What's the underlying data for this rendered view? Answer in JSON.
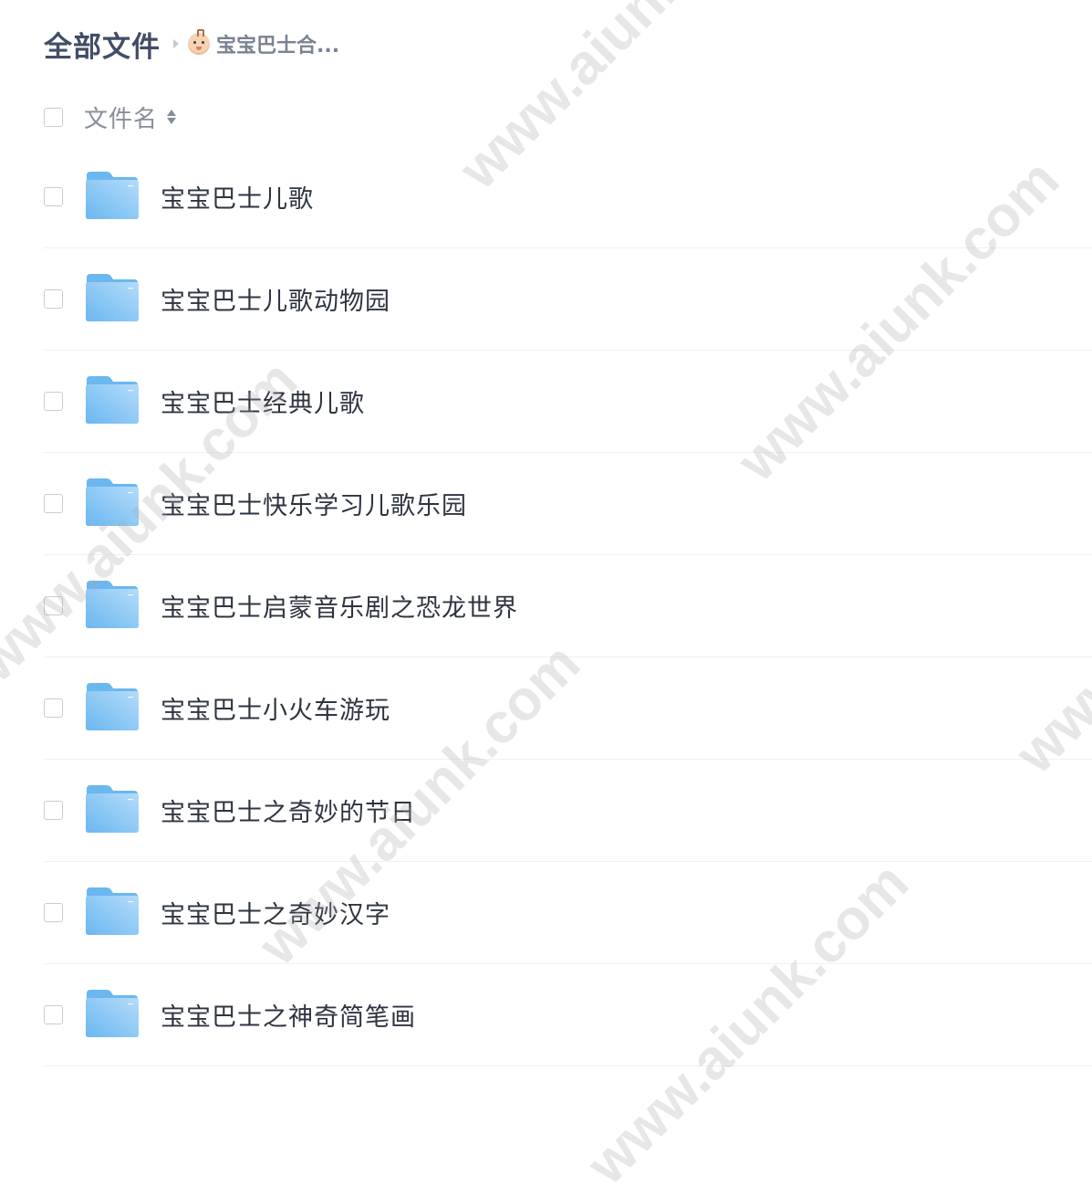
{
  "breadcrumb": {
    "root": "全部文件",
    "current": "宝宝巴士合..."
  },
  "list_header": {
    "name_label": "文件名"
  },
  "files": [
    {
      "name": "宝宝巴士儿歌"
    },
    {
      "name": "宝宝巴士儿歌动物园"
    },
    {
      "name": "宝宝巴士经典儿歌"
    },
    {
      "name": "宝宝巴士快乐学习儿歌乐园"
    },
    {
      "name": "宝宝巴士启蒙音乐剧之恐龙世界"
    },
    {
      "name": "宝宝巴士小火车游玩"
    },
    {
      "name": "宝宝巴士之奇妙的节日"
    },
    {
      "name": "宝宝巴士之奇妙汉字"
    },
    {
      "name": "宝宝巴士之神奇简笔画"
    }
  ],
  "watermark": {
    "text": "www.aiunk.com"
  },
  "icons": {
    "breadcrumb_separator": "chevron-right-icon",
    "breadcrumb_avatar": "baby-face-icon",
    "sort": "sort-icon",
    "folder": "folder-icon"
  },
  "colors": {
    "folder_light": "#b4dcfa",
    "folder_dark": "#6bb7f0",
    "text_primary": "#2e3440",
    "text_secondary": "#888e99"
  }
}
